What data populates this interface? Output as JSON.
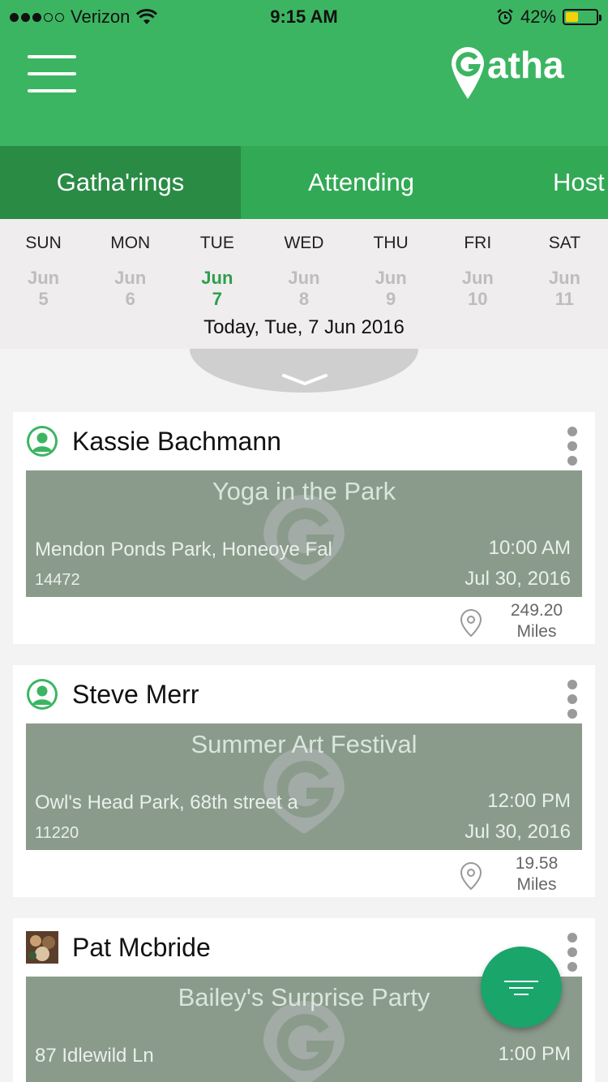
{
  "status": {
    "carrier": "Verizon",
    "time": "9:15 AM",
    "battery_pct": "42%",
    "battery_level": 0.42
  },
  "header": {
    "logo_text": "Gatha"
  },
  "tabs": [
    {
      "label": "Gatha'rings",
      "active": true
    },
    {
      "label": "Attending",
      "active": false
    },
    {
      "label": "Host",
      "active": false
    }
  ],
  "calendar": {
    "days": [
      {
        "dow": "SUN",
        "month": "Jun",
        "day": "5"
      },
      {
        "dow": "MON",
        "month": "Jun",
        "day": "6"
      },
      {
        "dow": "TUE",
        "month": "Jun",
        "day": "7",
        "today": true
      },
      {
        "dow": "WED",
        "month": "Jun",
        "day": "8"
      },
      {
        "dow": "THU",
        "month": "Jun",
        "day": "9"
      },
      {
        "dow": "FRI",
        "month": "Jun",
        "day": "10"
      },
      {
        "dow": "SAT",
        "month": "Jun",
        "day": "11"
      }
    ],
    "today_label": "Today, Tue, 7 Jun 2016"
  },
  "events": [
    {
      "host": "Kassie Bachmann",
      "title": "Yoga in the Park",
      "address": "Mendon Ponds Park, Honeoye Fal",
      "zip": "14472",
      "time": "10:00 AM",
      "date": "Jul 30, 2016",
      "distance": "249.20",
      "distance_unit": "Miles"
    },
    {
      "host": "Steve Merr",
      "title": "Summer Art Festival",
      "address": "Owl's Head Park, 68th street a",
      "zip": "11220",
      "time": "12:00 PM",
      "date": "Jul 30, 2016",
      "distance": "19.58",
      "distance_unit": "Miles"
    },
    {
      "host": "Pat Mcbride",
      "title": "Bailey's Surprise Party",
      "address": "87 Idlewild Ln",
      "zip": "",
      "time": "1:00 PM",
      "date": "",
      "distance": "",
      "distance_unit": ""
    }
  ],
  "colors": {
    "brand": "#3cb562",
    "tab_active": "#2a8b45",
    "event_bg": "#8a9b8c",
    "fab": "#1aa56a"
  }
}
